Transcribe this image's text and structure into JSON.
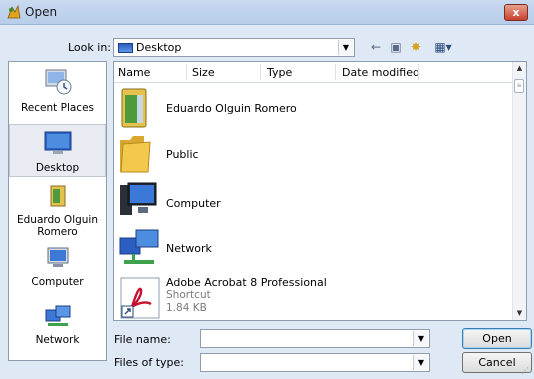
{
  "window": {
    "title": "Open",
    "close_label": "x"
  },
  "toolbar": {
    "look_in_label": "Look in:",
    "look_in_value": "Desktop",
    "back_glyph": "←",
    "up_glyph": "▣",
    "new_folder_glyph": "✸",
    "views_glyph": "▦▾"
  },
  "places": [
    {
      "label": "Recent Places",
      "icon": "recent-places-icon"
    },
    {
      "label": "Desktop",
      "icon": "desktop-icon"
    },
    {
      "label": "Eduardo Olguin Romero",
      "icon": "user-folder-icon"
    },
    {
      "label": "Computer",
      "icon": "computer-icon"
    },
    {
      "label": "Network",
      "icon": "network-icon"
    }
  ],
  "columns": {
    "name": "Name",
    "size": "Size",
    "type": "Type",
    "date": "Date modified"
  },
  "files": [
    {
      "name": "Eduardo Olguin Romero",
      "icon": "user-folder-icon"
    },
    {
      "name": "Public",
      "icon": "folder-icon"
    },
    {
      "name": "Computer",
      "icon": "computer-icon"
    },
    {
      "name": "Network",
      "icon": "network-icon"
    },
    {
      "name": "Adobe Acrobat 8 Professional",
      "type": "Shortcut",
      "size": "1.84 KB",
      "icon": "adobe-acrobat-shortcut-icon"
    }
  ],
  "bottom": {
    "file_name_label": "File name:",
    "file_name_value": "",
    "files_of_type_label": "Files of type:",
    "files_of_type_value": "",
    "open_label": "Open",
    "cancel_label": "Cancel"
  },
  "colors": {
    "titlebar": "#c9daf0",
    "dialog_bg": "#dfe8f5",
    "close": "#c7402a",
    "folder": "#f2c94c"
  }
}
